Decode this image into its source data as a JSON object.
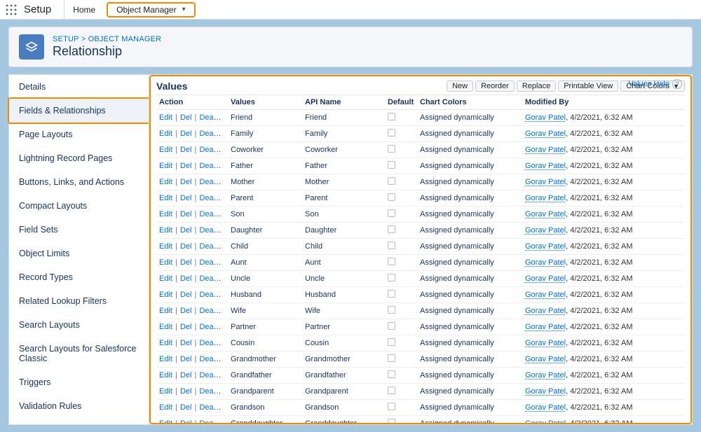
{
  "topbar": {
    "setup": "Setup",
    "home": "Home",
    "object_manager": "Object Manager"
  },
  "header": {
    "breadcrumb_setup": "SETUP",
    "breadcrumb_sep": " > ",
    "breadcrumb_om": "OBJECT MANAGER",
    "title": "Relationship"
  },
  "sidebar": {
    "items": [
      {
        "label": "Details"
      },
      {
        "label": "Fields & Relationships",
        "selected": true
      },
      {
        "label": "Page Layouts"
      },
      {
        "label": "Lightning Record Pages"
      },
      {
        "label": "Buttons, Links, and Actions"
      },
      {
        "label": "Compact Layouts"
      },
      {
        "label": "Field Sets"
      },
      {
        "label": "Object Limits"
      },
      {
        "label": "Record Types"
      },
      {
        "label": "Related Lookup Filters"
      },
      {
        "label": "Search Layouts"
      },
      {
        "label": "Search Layouts for Salesforce Classic"
      },
      {
        "label": "Triggers"
      },
      {
        "label": "Validation Rules"
      }
    ]
  },
  "values": {
    "title": "Values",
    "buttons": {
      "new": "New",
      "reorder": "Reorder",
      "replace": "Replace",
      "printable": "Printable View",
      "chart_colors": "Chart Colors"
    },
    "help": "Values Help",
    "columns": {
      "action": "Action",
      "values": "Values",
      "api": "API Name",
      "default": "Default",
      "colors": "Chart Colors",
      "modified": "Modified By"
    },
    "action_labels": {
      "edit": "Edit",
      "del": "Del",
      "deactivate": "Deactivate"
    },
    "chart_color_value": "Assigned dynamically",
    "mod_by_name": "Gorav Patel",
    "mod_by_date": ", 4/2/2021, 6:32 AM",
    "rows": [
      {
        "v": "Friend",
        "a": "Friend"
      },
      {
        "v": "Family",
        "a": "Family"
      },
      {
        "v": "Coworker",
        "a": "Coworker"
      },
      {
        "v": "Father",
        "a": "Father"
      },
      {
        "v": "Mother",
        "a": "Mother"
      },
      {
        "v": "Parent",
        "a": "Parent"
      },
      {
        "v": "Son",
        "a": "Son"
      },
      {
        "v": "Daughter",
        "a": "Daughter"
      },
      {
        "v": "Child",
        "a": "Child"
      },
      {
        "v": "Aunt",
        "a": "Aunt"
      },
      {
        "v": "Uncle",
        "a": "Uncle"
      },
      {
        "v": "Husband",
        "a": "Husband"
      },
      {
        "v": "Wife",
        "a": "Wife"
      },
      {
        "v": "Partner",
        "a": "Partner"
      },
      {
        "v": "Cousin",
        "a": "Cousin"
      },
      {
        "v": "Grandmother",
        "a": "Grandmother"
      },
      {
        "v": "Grandfather",
        "a": "Grandfather"
      },
      {
        "v": "Grandparent",
        "a": "Grandparent"
      },
      {
        "v": "Grandson",
        "a": "Grandson"
      },
      {
        "v": "Granddaughter",
        "a": "Granddaughter"
      }
    ]
  }
}
